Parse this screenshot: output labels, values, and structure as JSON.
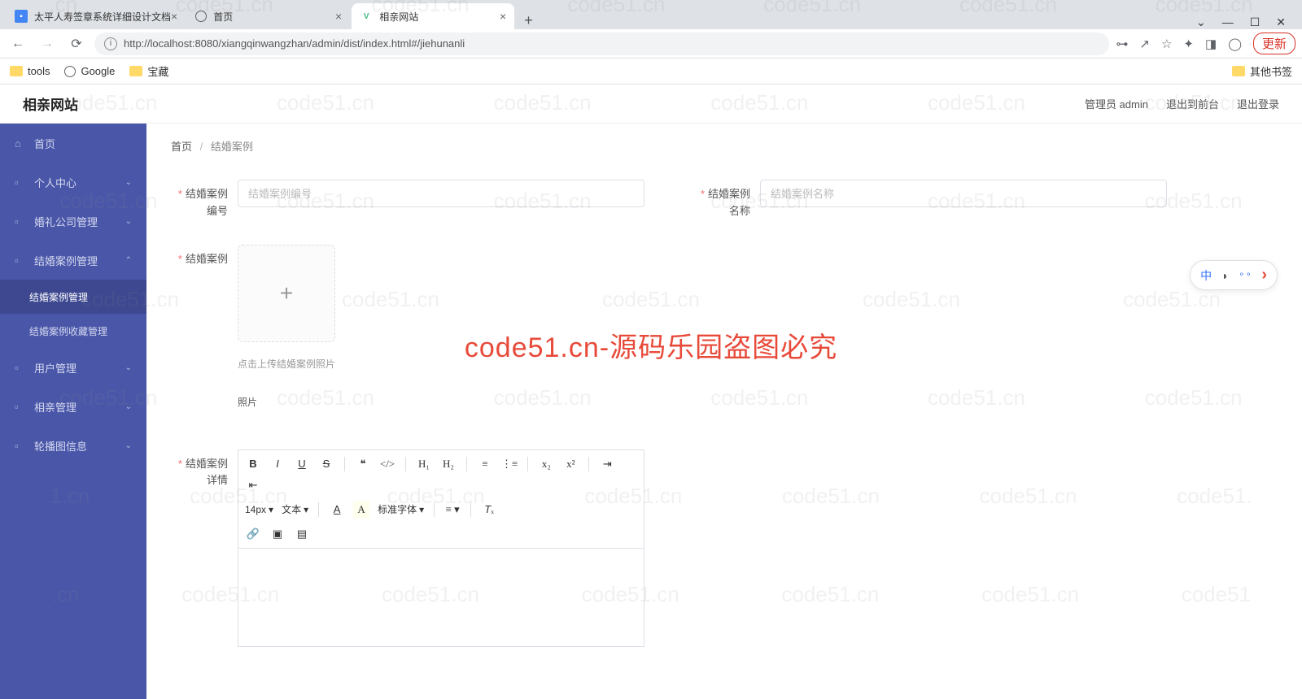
{
  "browser": {
    "tabs": [
      {
        "title": "太平人寿签章系统详细设计文档",
        "icon_color": "#4285f4"
      },
      {
        "title": "首页",
        "icon": "globe"
      },
      {
        "title": "相亲网站",
        "icon_color": "#41b883"
      }
    ],
    "url": "http://localhost:8080/xiangqinwangzhan/admin/dist/index.html#/jiehunanli",
    "update_label": "更新",
    "bookmarks": [
      {
        "label": "tools",
        "type": "folder"
      },
      {
        "label": "Google",
        "type": "globe"
      },
      {
        "label": "宝藏",
        "type": "folder"
      }
    ],
    "other_bookmarks": "其他书签",
    "window": {
      "min": "—",
      "max": "☐",
      "close": "✕",
      "dropdown": "⌄"
    }
  },
  "header": {
    "title": "相亲网站",
    "user_label": "管理员 admin",
    "to_front": "退出到前台",
    "logout": "退出登录"
  },
  "sidebar": {
    "items": [
      {
        "icon": "⌂",
        "label": "首页",
        "expandable": false
      },
      {
        "icon": "👤",
        "label": "个人中心",
        "expandable": true
      },
      {
        "icon": "☷",
        "label": "婚礼公司管理",
        "expandable": true
      },
      {
        "icon": "☰",
        "label": "结婚案例管理",
        "expandable": true,
        "open": true,
        "children": [
          {
            "label": "结婚案例管理"
          },
          {
            "label": "结婚案例收藏管理"
          }
        ]
      },
      {
        "icon": "✎",
        "label": "用户管理",
        "expandable": true
      },
      {
        "icon": "▦",
        "label": "相亲管理",
        "expandable": true
      },
      {
        "icon": "◉",
        "label": "轮播图信息",
        "expandable": true
      }
    ]
  },
  "breadcrumb": {
    "home": "首页",
    "current": "结婚案例"
  },
  "form": {
    "field_code": {
      "label": "结婚案例编号",
      "placeholder": "结婚案例编号"
    },
    "field_name": {
      "label": "结婚案例名称",
      "placeholder": "结婚案例名称"
    },
    "field_photo": {
      "label": "结婚案例",
      "hint": "点击上传结婚案例照片",
      "sublabel": "照片"
    },
    "field_detail": {
      "label": "结婚案例详情"
    },
    "editor_font_size": "14px",
    "editor_text_type": "文本",
    "editor_font_family": "标准字体"
  },
  "float_widget": {
    "cn": "中",
    "moon": "◗",
    "dots": "⚬⚬",
    "arrow": "›"
  },
  "watermark": {
    "text": "code51.cn",
    "center": "code51.cn-源码乐园盗图必究"
  }
}
